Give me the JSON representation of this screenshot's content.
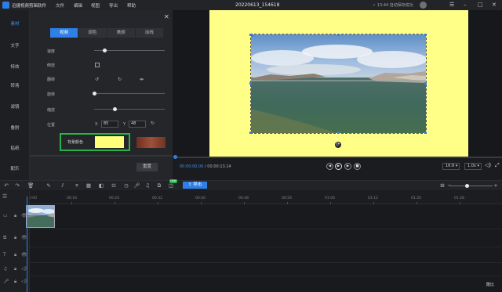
{
  "titlebar": {
    "app_name": "迅捷视频剪辑软件",
    "menus": [
      "文件",
      "编辑",
      "视图",
      "导出",
      "帮助"
    ],
    "project_name": "20220613_154618",
    "save_status": "13:44 自动保存成功"
  },
  "leftnav": {
    "items": [
      "素材",
      "文字",
      "特效",
      "转场",
      "滤镜",
      "叠附",
      "贴纸",
      "配乐"
    ],
    "active_index": 0
  },
  "panel": {
    "tabs": [
      "视频",
      "调色",
      "美颜",
      "动线"
    ],
    "active_tab": 0,
    "labels": {
      "speed": "速度",
      "reverse": "倒放",
      "flip": "翻转",
      "rotate": "旋转",
      "scale": "缩放",
      "position": "位置",
      "bg_color": "背景颜色"
    },
    "position": {
      "x_label": "X",
      "x_value": "85",
      "y_label": "Y",
      "y_value": "48"
    },
    "reset_label": "重置",
    "bg_color": "#ffff7a"
  },
  "player": {
    "current_time": "00:00:00.00",
    "total_time": "00:00:13.14",
    "aspect": "16:9",
    "speed": "1.0x"
  },
  "toolbar": {
    "export_label": "导出",
    "new_badge": "new"
  },
  "timeline": {
    "ticks": [
      "00:00",
      "00:16",
      "00:24",
      "00:32",
      "00:40",
      "00:48",
      "00:56",
      "01:04",
      "01:12",
      "01:20",
      "01:28"
    ]
  },
  "watermark": "酷比"
}
